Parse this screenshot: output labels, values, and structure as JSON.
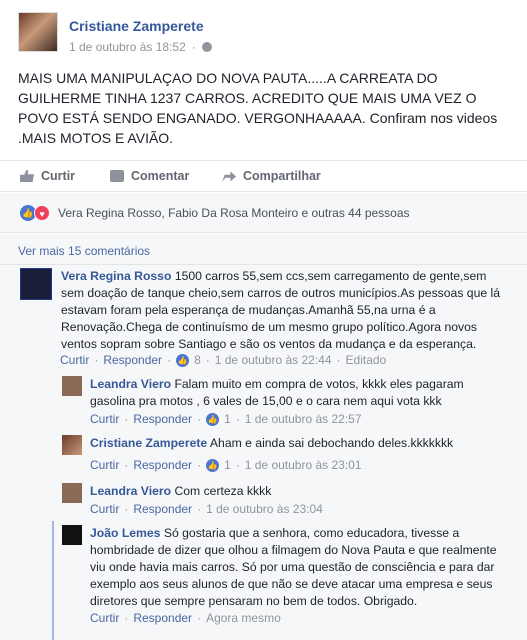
{
  "post": {
    "author": "Cristiane Zamperete",
    "timestamp": "1 de outubro às 18:52",
    "text": "MAIS UMA MANIPULAÇAO DO NOVA PAUTA.....A CARREATA DO GUILHERME TINHA 1237 CARROS. ACREDITO QUE MAIS UMA VEZ O POVO ESTÁ SENDO ENGANADO. VERGONHAAAAA. Confiram nos videos .MAIS MOTOS E AVIÃO."
  },
  "actions": {
    "like": "Curtir",
    "comment": "Comentar",
    "share": "Compartilhar"
  },
  "reactions": {
    "summary": "Vera Regina Rosso, Fabio Da Rosa Monteiro e outras 44 pessoas"
  },
  "more_comments": "Ver mais 15 comentários",
  "comments": [
    {
      "name": "Vera Regina Rosso",
      "text": "1500 carros 55,sem ccs,sem carregamento de gente,sem sem doação de tanque cheio,sem carros de outros municípios.As pessoas que lá estavam foram pela esperança de mudanças.Amanhã 55,na urna é a Renovação.Chega de continuísmo de um mesmo grupo político.Agora novos ventos sopram sobre Santiago e são os ventos da mudança e da esperança.",
      "like": "Curtir",
      "reply": "Responder",
      "likes": "8",
      "time": "1 de outubro às 22:44",
      "edited": "Editado"
    },
    {
      "name": "Leandra Viero",
      "text": "Falam muito em compra de votos, kkkk eles pagaram gasolina pra motos , 6 vales de 15,00 e o cara nem aqui vota kkk",
      "like": "Curtir",
      "reply": "Responder",
      "likes": "1",
      "time": "1 de outubro às 22:57"
    },
    {
      "name": "Cristiane Zamperete",
      "text": "Aham e ainda sai debochando deles.kkkkkkk",
      "like": "Curtir",
      "reply": "Responder",
      "likes": "1",
      "time": "1 de outubro às 23:01"
    },
    {
      "name": "Leandra Viero",
      "text": "Com certeza kkkk",
      "like": "Curtir",
      "reply": "Responder",
      "time": "1 de outubro às 23:04"
    },
    {
      "name": "João Lemes",
      "text": "Só gostaria que a senhora, como educadora, tivesse a hombridade de dizer que olhou a filmagem do Nova Pauta e que realmente viu onde havia mais carros. Só por uma questão de consciência e para dar exemplo aos seus alunos de que não se deve atacar uma empresa e seus diretores que sempre pensaram no bem de todos. Obrigado.",
      "like": "Curtir",
      "reply": "Responder",
      "time": "Agora mesmo"
    }
  ],
  "separators": {
    "dot": "·"
  },
  "colors": {
    "link": "#365899",
    "meta": "#90949c",
    "like_blue": "#4a76d1",
    "love_red": "#f0405c"
  }
}
